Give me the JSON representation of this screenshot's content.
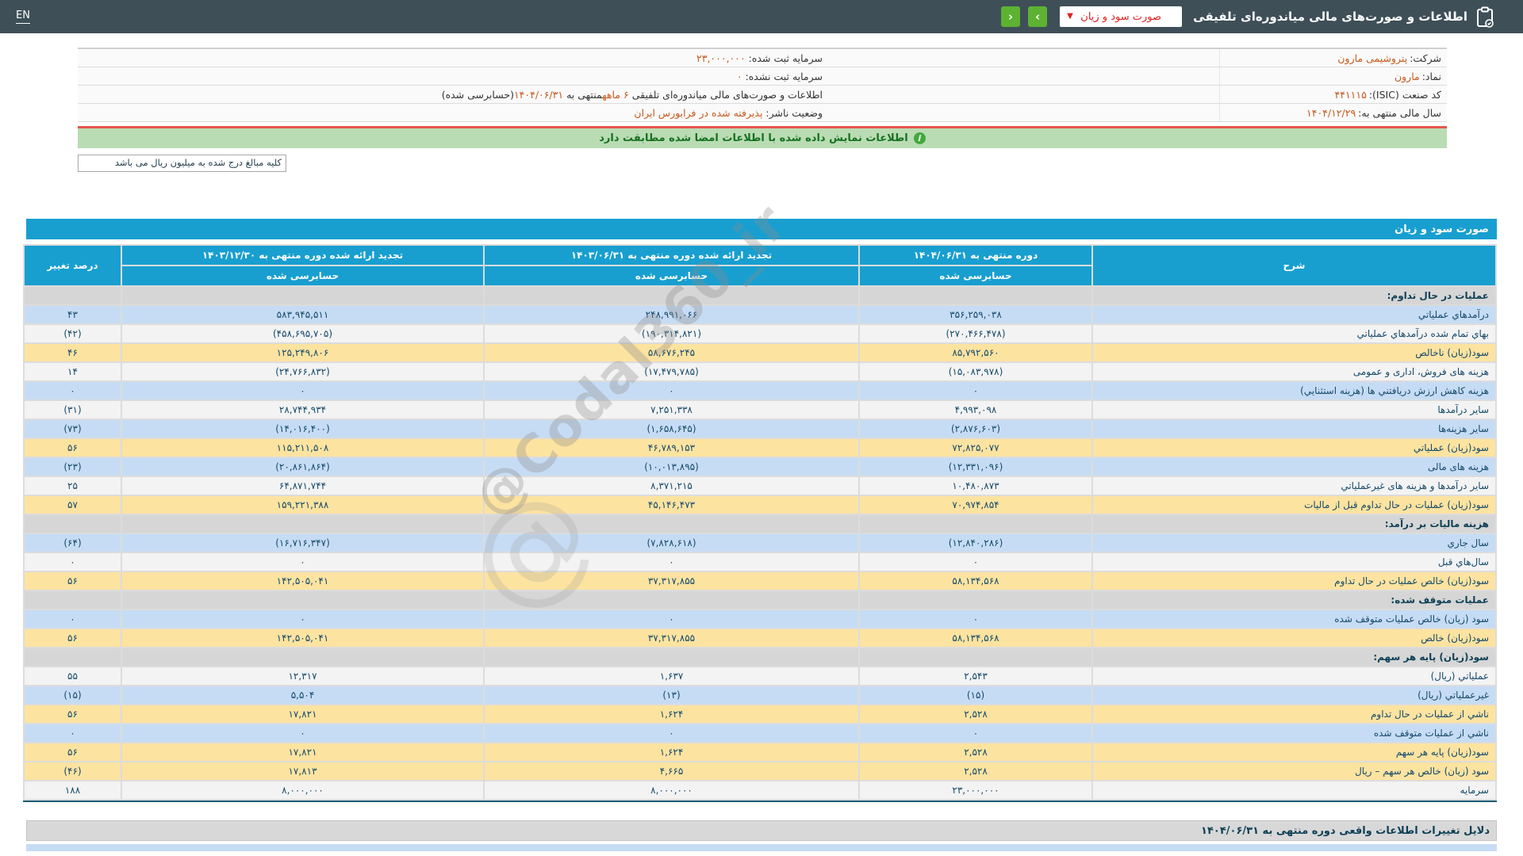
{
  "topbar": {
    "language": "EN",
    "title": "اطلاعات و صورت‌های مالی میاندوره‌ای تلفیقی",
    "report_select": {
      "value": "صورت سود و زیان",
      "chevron": "▼"
    },
    "nav": {
      "next_glyph": "›",
      "prev_glyph": "‹"
    }
  },
  "company_info": {
    "rows": [
      {
        "right": [
          {
            "t": "شرکت: "
          },
          {
            "t": "پتروشیمی مارون",
            "hl": true
          }
        ],
        "left": [
          {
            "t": "سرمایه ثبت شده: "
          },
          {
            "t": "۲۳,۰۰۰,۰۰۰",
            "hl": true
          }
        ]
      },
      {
        "right": [
          {
            "t": "نماد: "
          },
          {
            "t": "مارون",
            "hl": true
          }
        ],
        "left": [
          {
            "t": "سرمایه ثبت نشده: "
          },
          {
            "t": "۰",
            "hl": true
          }
        ]
      },
      {
        "right": [
          {
            "t": "کد صنعت (ISIC): "
          },
          {
            "t": "۴۴۱۱۱۵",
            "hl": true
          }
        ],
        "left": [
          {
            "t": "اطلاعات و صورت‌های مالی میاندوره‌ای تلفیقی "
          },
          {
            "t": "۶ ماهه",
            "hl": true
          },
          {
            "t": "منتهی به "
          },
          {
            "t": "۱۴۰۴/۰۶/۳۱",
            "hl": true
          },
          {
            "t": "(حسابرسی شده)"
          }
        ]
      },
      {
        "right": [
          {
            "t": "سال مالی منتهی به: "
          },
          {
            "t": "۱۴۰۴/۱۲/۲۹",
            "hl": true
          }
        ],
        "left": [
          {
            "t": "وضعیت ناشر: "
          },
          {
            "t": "پذیرفته شده در فرابورس ایران",
            "hl": true
          }
        ]
      }
    ]
  },
  "message_bar": {
    "text": "اطلاعات نمایش داده شده با اطلاعات امضا شده مطابقت دارد",
    "icon": "i"
  },
  "unit_note": "کلیه مبالغ درج شده به میلیون ریال می باشد",
  "statement_table": {
    "title": "صورت سود و زیان",
    "columns": {
      "desc": "شرح",
      "p1": "دوره منتهی به ۱۴۰۴/۰۶/۳۱",
      "p2": "تجدید ارائه شده دوره منتهی به ۱۴۰۳/۰۶/۳۱",
      "p3": "تجدید ارائه شده دوره منتهی به ۱۴۰۳/۱۲/۳۰",
      "pct": "درصد تغییر",
      "audited": "حسابرسی شده"
    },
    "rows": [
      {
        "type": "section",
        "label": "عملیات در حال تداوم:"
      },
      {
        "type": "data",
        "style": "blue",
        "label": "درآمدهاي عملياتي",
        "values": [
          "۳۵۶,۲۵۹,۰۳۸",
          "۲۴۸,۹۹۱,۰۶۶",
          "۵۸۳,۹۴۵,۵۱۱",
          "۴۳"
        ],
        "neg": [
          false,
          false,
          false,
          false
        ]
      },
      {
        "type": "data",
        "style": "white",
        "label": "بهاي تمام شده درآمدهاي عملياتي",
        "values": [
          "(۲۷۰,۴۶۶,۴۷۸)",
          "(۱۹۰,۳۱۴,۸۲۱)",
          "(۴۵۸,۶۹۵,۷۰۵)",
          "(۴۲)"
        ],
        "neg": [
          true,
          true,
          true,
          true
        ]
      },
      {
        "type": "data",
        "style": "yellow",
        "label": "سود(زيان) ناخالص",
        "values": [
          "۸۵,۷۹۲,۵۶۰",
          "۵۸,۶۷۶,۲۴۵",
          "۱۲۵,۲۴۹,۸۰۶",
          "۴۶"
        ],
        "neg": [
          false,
          false,
          false,
          false
        ]
      },
      {
        "type": "data",
        "style": "white",
        "label": "هزينه هاى فروش، ادارى و عمومى",
        "values": [
          "(۱۵,۰۸۳,۹۷۸)",
          "(۱۷,۴۷۹,۷۸۵)",
          "(۲۴,۷۶۶,۸۳۲)",
          "۱۴"
        ],
        "neg": [
          true,
          true,
          true,
          false
        ]
      },
      {
        "type": "data",
        "style": "blue",
        "label": "هزينه كاهش ارزش دريافتني ها (هزينه استثنايي)",
        "values": [
          "۰",
          "۰",
          "۰",
          "۰"
        ],
        "neg": [
          false,
          false,
          false,
          false
        ]
      },
      {
        "type": "data",
        "style": "white",
        "label": "ساير درآمدها",
        "values": [
          "۴,۹۹۳,۰۹۸",
          "۷,۲۵۱,۳۳۸",
          "۲۸,۷۴۴,۹۳۴",
          "(۳۱)"
        ],
        "neg": [
          false,
          false,
          false,
          true
        ]
      },
      {
        "type": "data",
        "style": "blue",
        "label": "ساير هزينه‌ها",
        "values": [
          "(۲,۸۷۶,۶۰۳)",
          "(۱,۶۵۸,۶۴۵)",
          "(۱۴,۰۱۶,۴۰۰)",
          "(۷۳)"
        ],
        "neg": [
          true,
          true,
          true,
          true
        ]
      },
      {
        "type": "data",
        "style": "yellow",
        "label": "سود(زيان) عملياتي",
        "values": [
          "۷۲,۸۲۵,۰۷۷",
          "۴۶,۷۸۹,۱۵۳",
          "۱۱۵,۲۱۱,۵۰۸",
          "۵۶"
        ],
        "neg": [
          false,
          false,
          false,
          false
        ]
      },
      {
        "type": "data",
        "style": "blue",
        "label": "هزينه هاى مالى",
        "values": [
          "(۱۲,۳۳۱,۰۹۶)",
          "(۱۰,۰۱۳,۸۹۵)",
          "(۲۰,۸۶۱,۸۶۴)",
          "(۲۳)"
        ],
        "neg": [
          true,
          true,
          true,
          true
        ]
      },
      {
        "type": "data",
        "style": "white",
        "label": "ساير درآمدها و هزينه هاى غيرعملياتي",
        "values": [
          "۱۰,۴۸۰,۸۷۳",
          "۸,۳۷۱,۲۱۵",
          "۶۴,۸۷۱,۷۴۴",
          "۲۵"
        ],
        "neg": [
          false,
          false,
          false,
          false
        ]
      },
      {
        "type": "data",
        "style": "yellow",
        "label": "سود(زيان) عمليات در حال تداوم قبل از ماليات",
        "values": [
          "۷۰,۹۷۴,۸۵۴",
          "۴۵,۱۴۶,۴۷۳",
          "۱۵۹,۲۲۱,۳۸۸",
          "۵۷"
        ],
        "neg": [
          false,
          false,
          false,
          false
        ]
      },
      {
        "type": "section",
        "label": "هزينه ماليات بر درآمد:"
      },
      {
        "type": "data",
        "style": "blue",
        "label": "سال جاري",
        "values": [
          "(۱۲,۸۴۰,۲۸۶)",
          "(۷,۸۲۸,۶۱۸)",
          "(۱۶,۷۱۶,۳۴۷)",
          "(۶۴)"
        ],
        "neg": [
          true,
          true,
          true,
          true
        ]
      },
      {
        "type": "data",
        "style": "white",
        "label": "سال‌هاي قبل",
        "values": [
          "۰",
          "۰",
          "۰",
          "۰"
        ],
        "neg": [
          false,
          false,
          false,
          false
        ]
      },
      {
        "type": "data",
        "style": "yellow",
        "label": "سود(زيان) خالص عمليات در حال تداوم",
        "values": [
          "۵۸,۱۳۴,۵۶۸",
          "۳۷,۳۱۷,۸۵۵",
          "۱۴۲,۵۰۵,۰۴۱",
          "۵۶"
        ],
        "neg": [
          false,
          false,
          false,
          false
        ]
      },
      {
        "type": "section",
        "label": "عمليات متوقف شده:"
      },
      {
        "type": "data",
        "style": "blue",
        "label": "سود (زيان) خالص عمليات متوقف شده",
        "values": [
          "۰",
          "۰",
          "۰",
          "۰"
        ],
        "neg": [
          false,
          false,
          false,
          false
        ]
      },
      {
        "type": "data",
        "style": "yellow",
        "label": "سود(زيان) خالص",
        "values": [
          "۵۸,۱۳۴,۵۶۸",
          "۳۷,۳۱۷,۸۵۵",
          "۱۴۲,۵۰۵,۰۴۱",
          "۵۶"
        ],
        "neg": [
          false,
          false,
          false,
          false
        ]
      },
      {
        "type": "section",
        "label": "سود(زيان) پايه هر سهم:"
      },
      {
        "type": "data",
        "style": "white",
        "label": "عملياتي (ريال)",
        "values": [
          "۲,۵۴۳",
          "۱,۶۳۷",
          "۱۲,۳۱۷",
          "۵۵"
        ],
        "neg": [
          false,
          false,
          false,
          false
        ]
      },
      {
        "type": "data",
        "style": "blue",
        "label": "غيرعملياتي (ريال)",
        "values": [
          "(۱۵)",
          "(۱۳)",
          "۵,۵۰۴",
          "(۱۵)"
        ],
        "neg": [
          true,
          true,
          false,
          true
        ]
      },
      {
        "type": "data",
        "style": "yellow",
        "label": "ناشي از عمليات در حال تداوم",
        "values": [
          "۲,۵۲۸",
          "۱,۶۲۴",
          "۱۷,۸۲۱",
          "۵۶"
        ],
        "neg": [
          false,
          false,
          false,
          false
        ]
      },
      {
        "type": "data",
        "style": "blue",
        "label": "ناشي از عمليات متوقف شده",
        "values": [
          "۰",
          "۰",
          "۰",
          "۰"
        ],
        "neg": [
          false,
          false,
          false,
          false
        ]
      },
      {
        "type": "data",
        "style": "yellow",
        "label": "سود(زيان) پايه هر سهم",
        "values": [
          "۲,۵۲۸",
          "۱,۶۲۴",
          "۱۷,۸۲۱",
          "۵۶"
        ],
        "neg": [
          false,
          false,
          false,
          false
        ]
      },
      {
        "type": "data",
        "style": "yellow",
        "label": "سود (زيان) خالص هر سهم – ريال",
        "values": [
          "۲,۵۲۸",
          "۴,۶۶۵",
          "۱۷,۸۱۳",
          "(۴۶)"
        ],
        "neg": [
          false,
          false,
          false,
          true
        ]
      },
      {
        "type": "data",
        "style": "white",
        "label": "سرمايه",
        "values": [
          "۲۳,۰۰۰,۰۰۰",
          "۸,۰۰۰,۰۰۰",
          "۸,۰۰۰,۰۰۰",
          "۱۸۸"
        ],
        "neg": [
          false,
          false,
          false,
          false
        ]
      }
    ]
  },
  "watermark": "@Codal360_ir",
  "watermark_glyph": "@",
  "reasons_bar": "دلایل تغییرات اطلاعات واقعی دوره منتهی به ۱۴۰۴/۰۶/۳۱",
  "colors": {
    "topbar_bg": "#3e4f58",
    "accent_blue": "#189fd0",
    "row_blue": "#c6dcf4",
    "row_yellow": "#fce3a0",
    "row_white": "#f3f3f3",
    "section_gray": "#d6d6d6",
    "negative_red": "#e31d1d",
    "value_navy": "#15496b",
    "highlight_orange": "#c85a1e",
    "message_green_bg": "#b9dcb4",
    "message_red_border": "#e2574d",
    "nav_green": "#5db232"
  }
}
